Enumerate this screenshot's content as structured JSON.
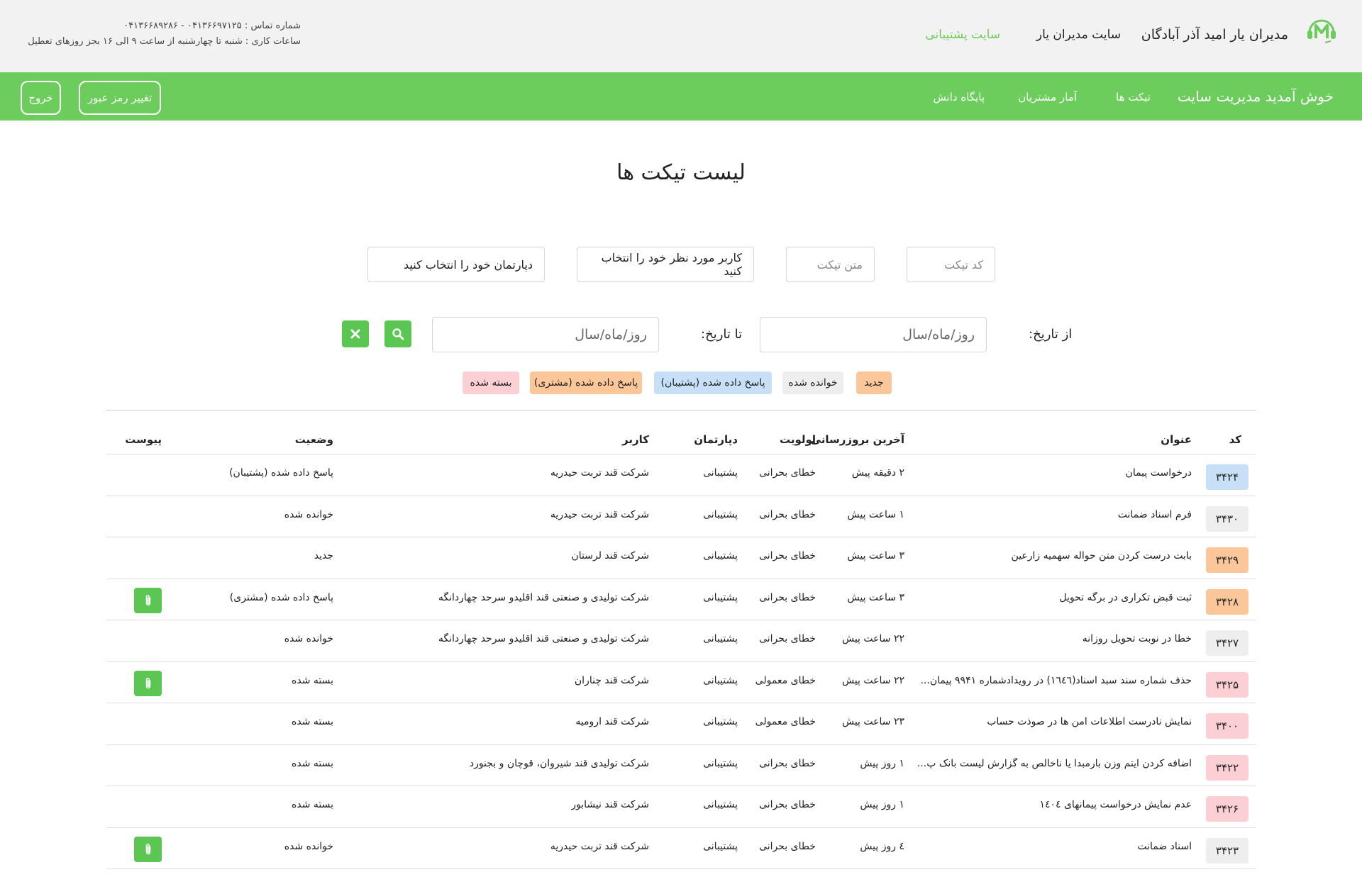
{
  "header": {
    "brand_title": "مدیران یار امید آذر آبادگان",
    "brand_link": "سایت مدیران یار",
    "support_link": "سایت پشتیبانی",
    "contact_line": "شماره تماس : ۰۴۱۳۶۶۹۷۱۲۵ - ۰۴۱۳۶۶۸۹۲۸۶",
    "hours_line": "ساعات کاری : شنبه تا چهارشنبه از ساعت ۹ الی ۱۶ بجز روزهای تعطیل"
  },
  "nav": {
    "welcome": "خوش آمدید مدیریت سایت",
    "tickets": "تیکت ها",
    "customers": "آمار مشتریان",
    "knowledge": "پایگاه دانش",
    "change_password": "تغییر رمز عبور",
    "logout": "خروج"
  },
  "page_title": "لیست تیکت ها",
  "filters": {
    "ticket_code_placeholder": "کد تیکت",
    "ticket_text_placeholder": "متن تیکت",
    "user_select": "کاربر مورد نظر خود را انتخاب کنید",
    "department_select": "دپارتمان خود را انتخاب کنید",
    "from_label": "از تاریخ:",
    "to_label": "تا تاریخ:",
    "date_placeholder": "روز/ماه/سال"
  },
  "legend": [
    {
      "label": "جدید",
      "color": "#fbc79a"
    },
    {
      "label": "خوانده شده",
      "color": "#eeeeee"
    },
    {
      "label": "پاسخ داده شده (پشتیبان)",
      "color": "#c7e0f7"
    },
    {
      "label": "پاسخ داده شده (مشتری)",
      "color": "#fbc79a"
    },
    {
      "label": "بسته شده",
      "color": "#fbcfd3"
    }
  ],
  "table": {
    "headers": {
      "code": "کد",
      "title": "عنوان",
      "updated": "آخرین بروزرسانی",
      "priority": "اولویت",
      "department": "دپارتمان",
      "user": "کاربر",
      "status": "وضعیت",
      "attachment": "پیوست"
    },
    "rows": [
      {
        "code": "۳۴۲۴",
        "badge": "#c7e0f7",
        "title": "درخواست پیمان",
        "updated": "۲ دقیقه پیش",
        "priority": "خطای بحرانی",
        "department": "پشتیبانی",
        "user": "شرکت قند تربت حیدریه",
        "status": "پاسخ داده شده (پشتیبان)",
        "attachment": false
      },
      {
        "code": "۳۴۳۰",
        "badge": "#eeeeee",
        "title": "فرم اسناد ضمانت",
        "updated": "۱ ساعت پیش",
        "priority": "خطای بحرانی",
        "department": "پشتیبانی",
        "user": "شرکت قند تربت حیدریه",
        "status": "خوانده شده",
        "attachment": false
      },
      {
        "code": "۳۴۲۹",
        "badge": "#fbc79a",
        "title": "بابت درست کردن متن حواله سهمیه زارعین",
        "updated": "۳ ساعت پیش",
        "priority": "خطای بحرانی",
        "department": "پشتیبانی",
        "user": "شرکت قند لرستان",
        "status": "جدید",
        "attachment": false
      },
      {
        "code": "۳۴۲۸",
        "badge": "#fbc79a",
        "title": "ثبت قبض تکراری در برگه تحویل",
        "updated": "۳ ساعت پیش",
        "priority": "خطای بحرانی",
        "department": "پشتیبانی",
        "user": "شرکت تولیدی و صنعتی قند اقلیدو سرحد چهاردانگه",
        "status": "پاسخ داده شده (مشتری)",
        "attachment": true
      },
      {
        "code": "۳۴۲۷",
        "badge": "#eeeeee",
        "title": "خطا در نوبت تحویل روزانه",
        "updated": "۲۲ ساعت پیش",
        "priority": "خطای بحرانی",
        "department": "پشتیبانی",
        "user": "شرکت تولیدی و صنعتی قند اقلیدو سرحد چهاردانگه",
        "status": "خوانده شده",
        "attachment": false
      },
      {
        "code": "۳۴۲۵",
        "badge": "#fbcfd3",
        "title": "حذف شماره سند سبد اسناد(۱٦٤٦) در رویدادشماره ۹۹۴۱ پیمان...",
        "updated": "۲۲ ساعت پیش",
        "priority": "خطای معمولی",
        "department": "پشتیبانی",
        "user": "شرکت قند چناران",
        "status": "بسته شده",
        "attachment": true
      },
      {
        "code": "۳۴۰۰",
        "badge": "#fbcfd3",
        "title": "نمایش نادرست اطلاعات امن ها در صوذت حساب",
        "updated": "۲۳ ساعت پیش",
        "priority": "خطای معمولی",
        "department": "پشتیبانی",
        "user": "شرکت قند ارومیه",
        "status": "بسته شده",
        "attachment": false
      },
      {
        "code": "۳۴۲۲",
        "badge": "#fbcfd3",
        "title": "اضافه کردن ایتم وزن بارمبدا یا ناخالص به گزارش لیست بانک پ...",
        "updated": "۱ روز پیش",
        "priority": "خطای بحرانی",
        "department": "پشتیبانی",
        "user": "شرکت تولیدی قند شیروان، قوچان و بجنورد",
        "status": "بسته شده",
        "attachment": false
      },
      {
        "code": "۳۴۲۶",
        "badge": "#fbcfd3",
        "title": "عدم نمایش درخواست پیمانهای ۱٤٠٤",
        "updated": "۱ روز پیش",
        "priority": "خطای بحرانی",
        "department": "پشتیبانی",
        "user": "شرکت قند نیشابور",
        "status": "بسته شده",
        "attachment": false
      },
      {
        "code": "۳۴۲۳",
        "badge": "#eeeeee",
        "title": "اسناد ضمانت",
        "updated": "٤ روز پیش",
        "priority": "خطای بحرانی",
        "department": "پشتیبانی",
        "user": "شرکت قند تربت حیدریه",
        "status": "خوانده شده",
        "attachment": true
      }
    ]
  }
}
